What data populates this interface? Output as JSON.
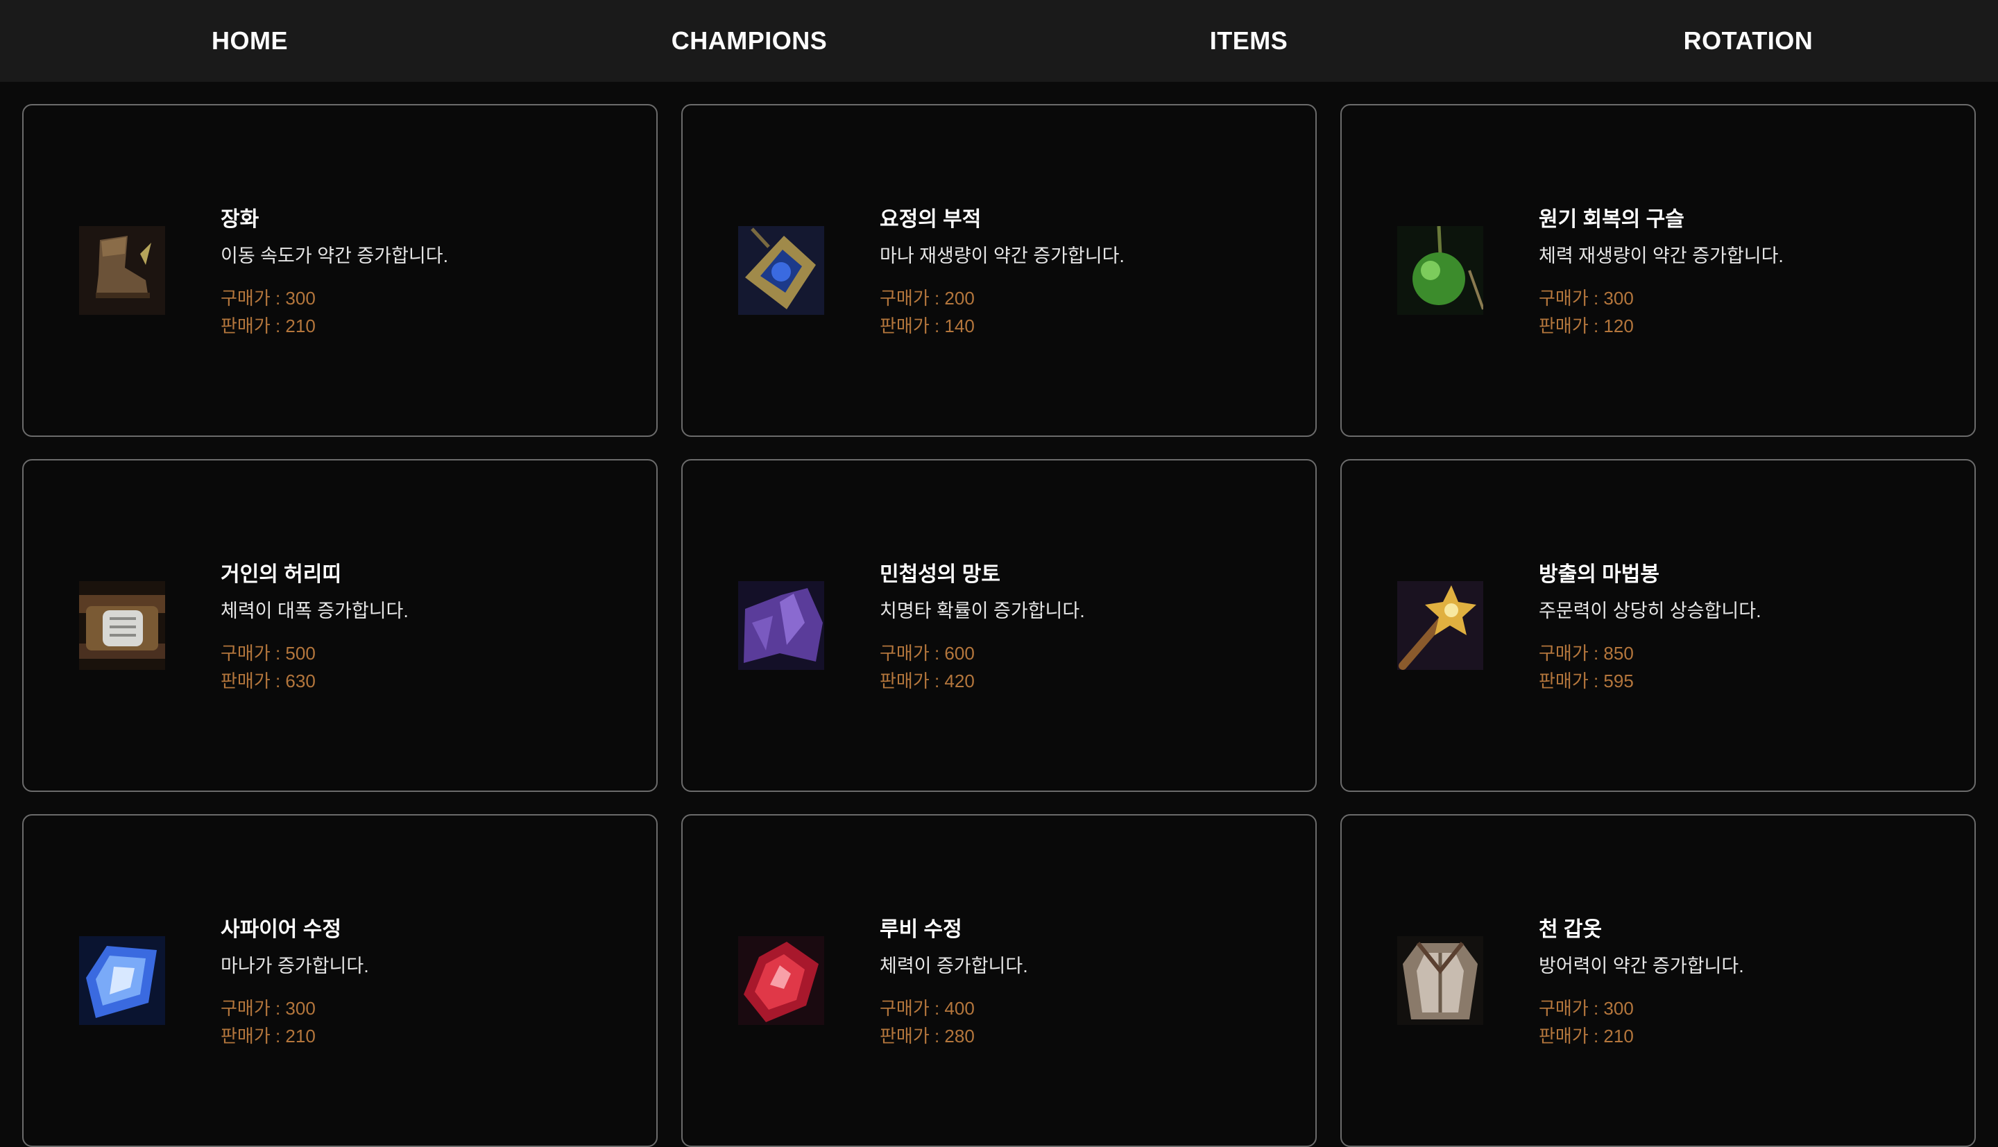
{
  "nav": [
    "HOME",
    "CHAMPIONS",
    "ITEMS",
    "ROTATION"
  ],
  "items": [
    {
      "name": "장화",
      "desc": "이동 속도가 약간 증가합니다.",
      "buy": "구매가 : 300",
      "sell": "판매가 : 210",
      "icon": "boots-icon"
    },
    {
      "name": "요정의 부적",
      "desc": "마나 재생량이 약간 증가합니다.",
      "buy": "구매가 : 200",
      "sell": "판매가 : 140",
      "icon": "amulet-icon"
    },
    {
      "name": "원기 회복의 구슬",
      "desc": "체력 재생량이 약간 증가합니다.",
      "buy": "구매가 : 300",
      "sell": "판매가 : 120",
      "icon": "orb-icon"
    },
    {
      "name": "거인의 허리띠",
      "desc": "체력이 대폭 증가합니다.",
      "buy": "구매가 : 500",
      "sell": "판매가 : 630",
      "icon": "belt-icon"
    },
    {
      "name": "민첩성의 망토",
      "desc": "치명타 확률이 증가합니다.",
      "buy": "구매가 : 600",
      "sell": "판매가 : 420",
      "icon": "cloak-icon"
    },
    {
      "name": "방출의 마법봉",
      "desc": "주문력이 상당히 상승합니다.",
      "buy": "구매가 : 850",
      "sell": "판매가 : 595",
      "icon": "wand-icon"
    },
    {
      "name": "사파이어 수정",
      "desc": "마나가 증가합니다.",
      "buy": "구매가 : 300",
      "sell": "판매가 : 210",
      "icon": "sapphire-icon"
    },
    {
      "name": "루비 수정",
      "desc": "체력이 증가합니다.",
      "buy": "구매가 : 400",
      "sell": "판매가 : 280",
      "icon": "ruby-icon"
    },
    {
      "name": "천 갑옷",
      "desc": "방어력이 약간 증가합니다.",
      "buy": "구매가 : 300",
      "sell": "판매가 : 210",
      "icon": "armor-icon"
    }
  ],
  "colors": {
    "background": "#0a0a0a",
    "nav": "#1a1a1a",
    "border": "#6b6b6b",
    "price": "#b4763c"
  }
}
